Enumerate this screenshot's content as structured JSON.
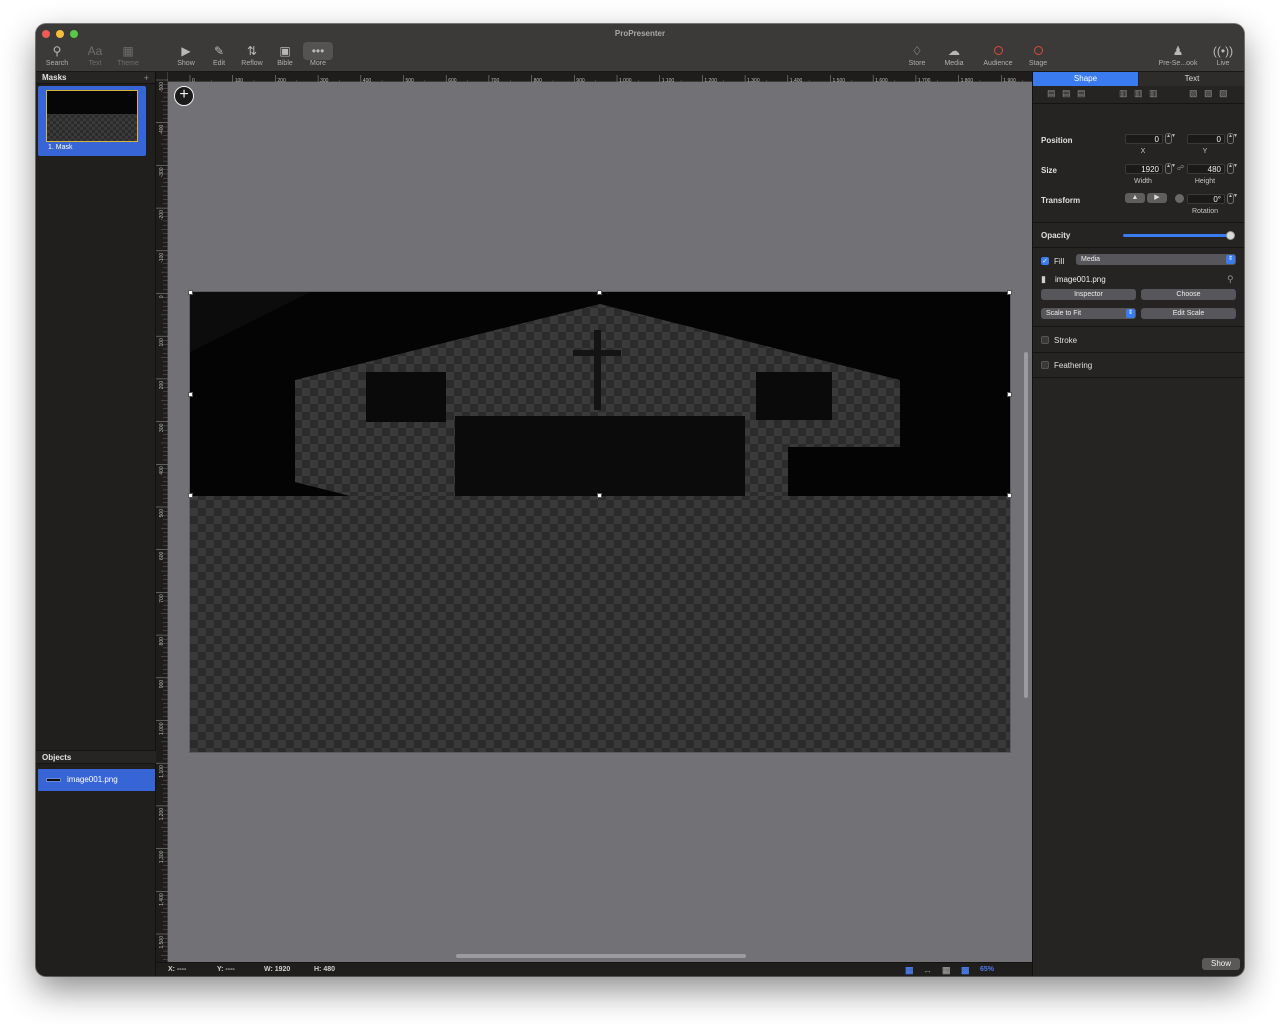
{
  "app": {
    "title": "ProPresenter",
    "traffic_lights": {
      "close": "#ee5c53",
      "minimize": "#f4bd3b",
      "zoom": "#5bc649"
    }
  },
  "toolbar": {
    "items": [
      {
        "label": "Search",
        "icon": "magnifier-icon"
      },
      {
        "label": "Text",
        "icon": "text-icon"
      },
      {
        "label": "Theme",
        "icon": "theme-icon"
      },
      {
        "label": "Show",
        "icon": "play-icon"
      },
      {
        "label": "Edit",
        "icon": "pencil-icon"
      },
      {
        "label": "Reflow",
        "icon": "reflow-icon"
      },
      {
        "label": "Bible",
        "icon": "bible-icon"
      },
      {
        "label": "More",
        "icon": "ellipsis-icon"
      },
      {
        "label": "Store",
        "icon": "cart-icon"
      },
      {
        "label": "Media",
        "icon": "media-icon"
      },
      {
        "label": "Audience",
        "icon": "audience-ring-icon"
      },
      {
        "label": "Stage",
        "icon": "stage-ring-icon"
      },
      {
        "label": "Pre-Se...ook",
        "icon": "preservice-icon"
      },
      {
        "label": "Live",
        "icon": "live-icon"
      }
    ]
  },
  "left_panel": {
    "masks_title": "Masks",
    "mask_items": [
      {
        "label": "1.  Mask"
      }
    ],
    "objects_title": "Objects",
    "objects": [
      {
        "label": "image001.png"
      }
    ]
  },
  "rulers": {
    "top_ticks": [
      "0",
      "100",
      "200",
      "300",
      "400",
      "500",
      "600",
      "700",
      "800",
      "900",
      "1,000",
      "1,100",
      "1,200",
      "1,300",
      "1,400",
      "1,500",
      "1,600",
      "1,700",
      "1,800",
      "1,900"
    ],
    "left_ticks": [
      "-500",
      "-400",
      "-300",
      "-200",
      "-100",
      "0",
      "100",
      "200",
      "300",
      "400",
      "500",
      "600",
      "700",
      "800",
      "900",
      "1,000",
      "1,100",
      "1,200",
      "1,300",
      "1,400",
      "1,500"
    ]
  },
  "status_bar": {
    "x": "X: ----",
    "y": "Y: ----",
    "w": "W: 1920",
    "h": "H: 480",
    "zoom": "65%"
  },
  "inspector": {
    "tabs": [
      "Shape",
      "Text"
    ],
    "active_tab": "Shape",
    "position": {
      "label": "Position",
      "x": "0",
      "y": "0",
      "x_label": "X",
      "y_label": "Y"
    },
    "size": {
      "label": "Size",
      "width": "1920",
      "height": "480",
      "width_label": "Width",
      "height_label": "Height"
    },
    "transform": {
      "label": "Transform",
      "rotation": "0°",
      "rotation_label": "Rotation"
    },
    "opacity": {
      "label": "Opacity",
      "value": 1.0
    },
    "fill": {
      "label": "Fill",
      "checked": true,
      "type": "Media",
      "file": "image001.png",
      "inspector_btn": "Inspector",
      "choose_btn": "Choose",
      "scale_mode": "Scale to Fit",
      "edit_scale_btn": "Edit Scale"
    },
    "stroke": {
      "label": "Stroke",
      "checked": false
    },
    "feathering": {
      "label": "Feathering",
      "checked": false
    },
    "show_btn": "Show"
  }
}
